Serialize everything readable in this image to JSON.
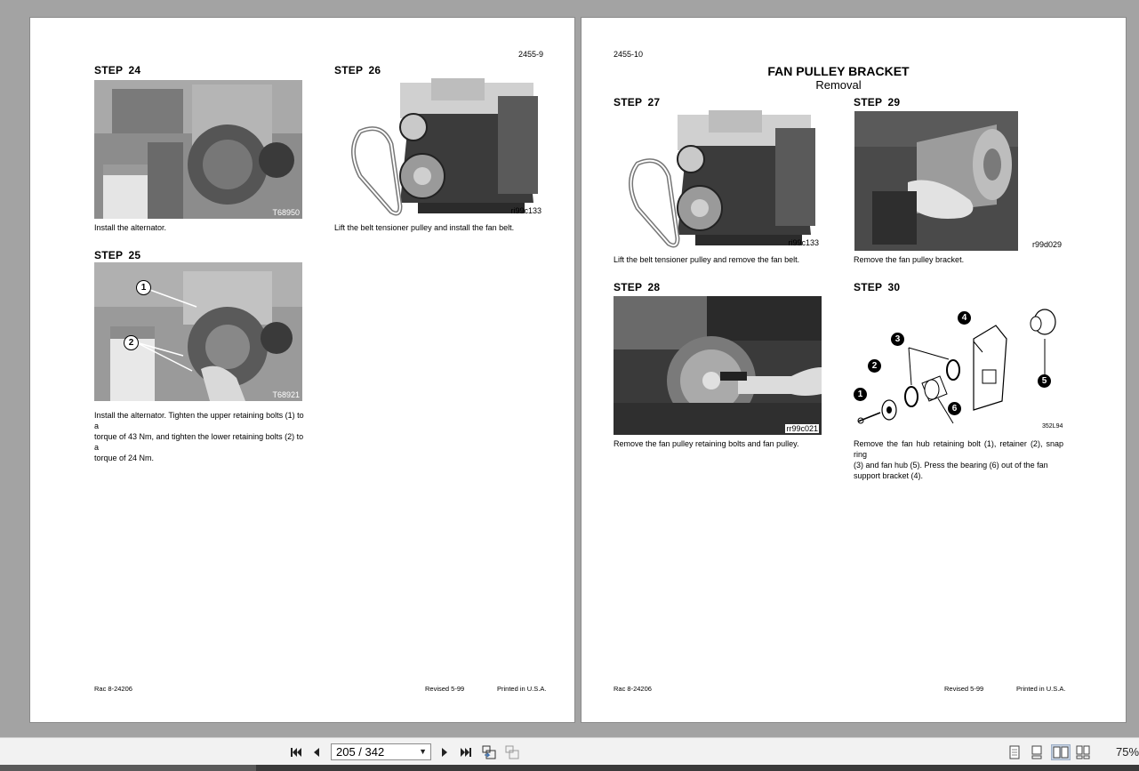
{
  "left_page": {
    "page_number": "2455-9",
    "step24": {
      "label": "STEP  24",
      "image_code": "T68950",
      "caption": "Install the alternator."
    },
    "step25": {
      "label": "STEP  25",
      "image_code": "T68921",
      "caption_lines": [
        "Install the alternator. Tighten the upper retaining bolts (1) to a",
        "torque of 43 Nm, and tighten the lower retaining bolts (2) to a",
        "torque of 24 Nm."
      ],
      "callouts": [
        "1",
        "2"
      ]
    },
    "step26": {
      "label": "STEP  26",
      "image_code": "ri99c133",
      "caption": "Lift the belt tensioner pulley and install the fan belt."
    },
    "footer": {
      "left": "Rac 8-24206",
      "revised": "Revised 5-99",
      "printed": "Printed in U.S.A."
    }
  },
  "right_page": {
    "page_number": "2455-10",
    "title": "FAN PULLEY BRACKET",
    "subtitle": "Removal",
    "step27": {
      "label": "STEP  27",
      "image_code": "ri99c133",
      "caption": "Lift the belt tensioner pulley and remove the fan belt."
    },
    "step28": {
      "label": "STEP  28",
      "image_code": "rr99c021",
      "caption": "Remove the fan pulley retaining bolts and fan pulley."
    },
    "step29": {
      "label": "STEP  29",
      "image_code": "r99d029",
      "caption": "Remove the fan pulley bracket."
    },
    "step30": {
      "label": "STEP  30",
      "image_code": "352L94",
      "caption_lines": [
        "Remove the fan hub retaining bolt (1), retainer (2), snap ring",
        "(3) and fan hub (5). Press the bearing (6) out of the fan",
        "support bracket (4)."
      ],
      "callouts": [
        "1",
        "2",
        "3",
        "4",
        "5",
        "6"
      ]
    },
    "footer": {
      "left": "Rac 8-24206",
      "revised": "Revised 5-99",
      "printed": "Printed in U.S.A."
    }
  },
  "toolbar": {
    "page_indicator": "205 / 342",
    "zoom": "75%",
    "icons": [
      "first-page-icon",
      "prev-page-icon",
      "next-page-icon",
      "last-page-icon",
      "go-back-icon",
      "go-forward-icon",
      "single-page-view-icon",
      "continuous-view-icon",
      "two-page-view-icon",
      "two-page-continuous-view-icon"
    ]
  }
}
